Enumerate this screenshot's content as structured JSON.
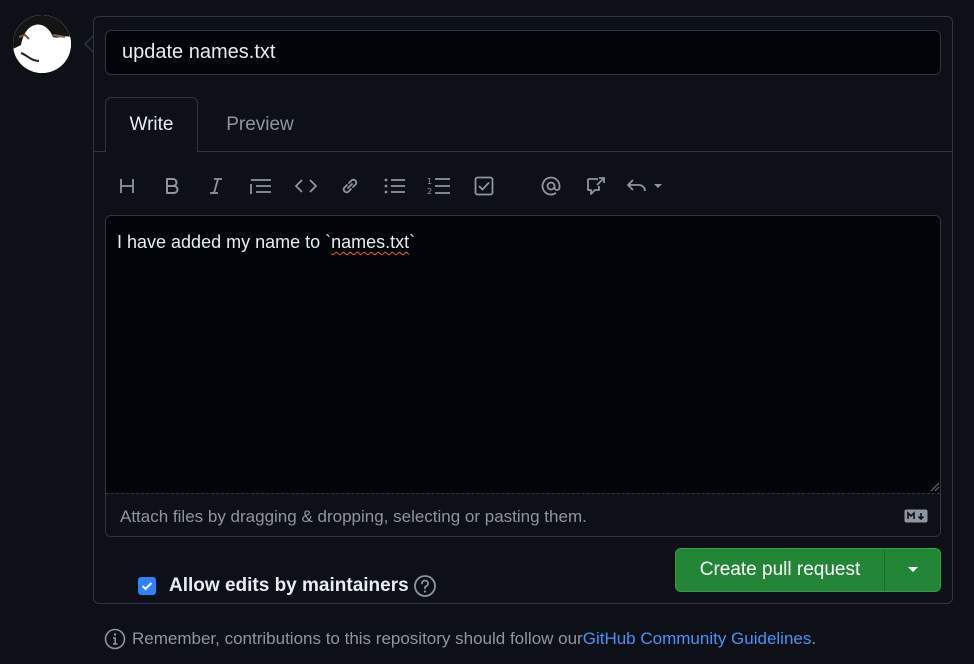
{
  "pr_title": "update names.txt",
  "tabs": {
    "write": "Write",
    "preview": "Preview"
  },
  "toolbar": {
    "icons": [
      "heading-icon",
      "bold-icon",
      "italic-icon",
      "quote-icon",
      "code-icon",
      "link-icon",
      "unordered-list-icon",
      "ordered-list-icon",
      "task-list-icon",
      "mention-icon",
      "reference-icon",
      "reply-icon"
    ]
  },
  "editor": {
    "body_text_before": "I have added my name to `",
    "body_text_spell": "names.txt",
    "body_text_after": "`",
    "attach_hint": "Attach files by dragging & dropping, selecting or pasting them."
  },
  "options": {
    "allow_edits_label": "Allow edits by maintainers",
    "allow_edits_checked": true
  },
  "actions": {
    "create_pr_label": "Create pull request"
  },
  "footer": {
    "text": "Remember, contributions to this repository should follow our ",
    "link": "GitHub Community Guidelines",
    "period": "."
  },
  "colors": {
    "accent": "#2f81f7",
    "primary_button": "#238636",
    "link": "#4493f8"
  }
}
